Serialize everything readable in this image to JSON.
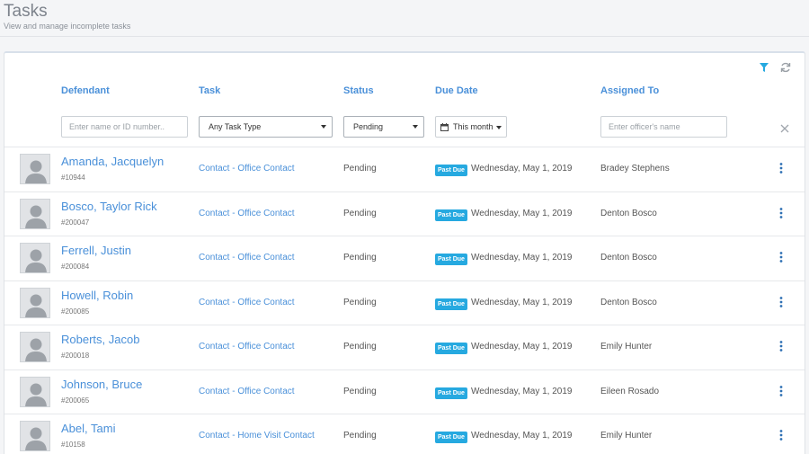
{
  "header": {
    "title": "Tasks",
    "subtitle": "View and manage incomplete tasks"
  },
  "toolbar": {
    "filter_icon": "filter-icon",
    "refresh_icon": "refresh-icon"
  },
  "columns": {
    "defendant": "Defendant",
    "task": "Task",
    "status": "Status",
    "due_date": "Due Date",
    "assigned_to": "Assigned To"
  },
  "filters": {
    "defendant_placeholder": "Enter name or ID number..",
    "task_type": "Any Task Type",
    "status": "Pending",
    "date_range": "This month",
    "officer_placeholder": "Enter officer's name"
  },
  "colors": {
    "accent": "#4a90d9",
    "badge": "#26a9e0"
  },
  "rows": [
    {
      "name": "Amanda, Jacquelyn",
      "id": "#10944",
      "task": "Contact - Office Contact",
      "status": "Pending",
      "badge": "Past Due",
      "due": "Wednesday, May 1, 2019",
      "assigned": "Bradey Stephens"
    },
    {
      "name": "Bosco, Taylor Rick",
      "id": "#200047",
      "task": "Contact - Office Contact",
      "status": "Pending",
      "badge": "Past Due",
      "due": "Wednesday, May 1, 2019",
      "assigned": "Denton Bosco"
    },
    {
      "name": "Ferrell, Justin",
      "id": "#200084",
      "task": "Contact - Office Contact",
      "status": "Pending",
      "badge": "Past Due",
      "due": "Wednesday, May 1, 2019",
      "assigned": "Denton Bosco"
    },
    {
      "name": "Howell, Robin",
      "id": "#200085",
      "task": "Contact - Office Contact",
      "status": "Pending",
      "badge": "Past Due",
      "due": "Wednesday, May 1, 2019",
      "assigned": "Denton Bosco"
    },
    {
      "name": "Roberts, Jacob",
      "id": "#200018",
      "task": "Contact - Office Contact",
      "status": "Pending",
      "badge": "Past Due",
      "due": "Wednesday, May 1, 2019",
      "assigned": "Emily Hunter"
    },
    {
      "name": "Johnson, Bruce",
      "id": "#200065",
      "task": "Contact - Office Contact",
      "status": "Pending",
      "badge": "Past Due",
      "due": "Wednesday, May 1, 2019",
      "assigned": "Eileen Rosado"
    },
    {
      "name": "Abel, Tami",
      "id": "#10158",
      "task": "Contact - Home Visit Contact",
      "status": "Pending",
      "badge": "Past Due",
      "due": "Wednesday, May 1, 2019",
      "assigned": "Emily Hunter"
    }
  ]
}
